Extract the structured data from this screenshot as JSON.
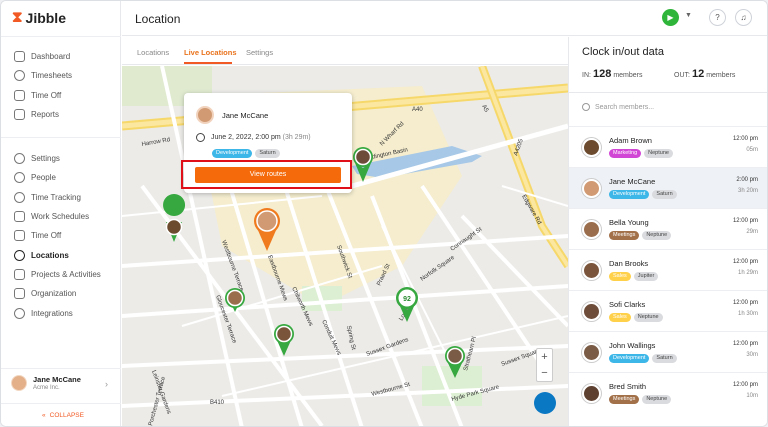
{
  "app": {
    "name": "Jibble",
    "brand_color": "#f15a24"
  },
  "sidebar": {
    "top_items": [
      {
        "label": "Dashboard",
        "icon": "dashboard-icon"
      },
      {
        "label": "Timesheets",
        "icon": "clock-icon"
      },
      {
        "label": "Time Off",
        "icon": "hourglass-icon"
      },
      {
        "label": "Reports",
        "icon": "report-icon"
      }
    ],
    "settings_items": [
      {
        "label": "Settings",
        "icon": "gear-icon"
      },
      {
        "label": "People",
        "icon": "people-icon"
      },
      {
        "label": "Time Tracking",
        "icon": "time-tracking-icon"
      },
      {
        "label": "Work Schedules",
        "icon": "schedule-icon"
      },
      {
        "label": "Time Off",
        "icon": "time-off-icon"
      },
      {
        "label": "Locations",
        "icon": "location-pin-icon",
        "active": true
      },
      {
        "label": "Projects & Activities",
        "icon": "tag-icon"
      },
      {
        "label": "Organization",
        "icon": "organization-icon"
      },
      {
        "label": "Integrations",
        "icon": "plug-icon"
      }
    ],
    "user": {
      "name": "Jane McCane",
      "org": "Acme Inc."
    },
    "collapse_label": "COLLAPSE"
  },
  "header": {
    "title": "Location",
    "status_color": "#2fb53a"
  },
  "tabs": [
    {
      "label": "Locations",
      "active": false
    },
    {
      "label": "Live Locations",
      "active": true
    },
    {
      "label": "Settings",
      "active": false
    }
  ],
  "map": {
    "street_labels": [
      "A40",
      "A5",
      "A4205",
      "Paddington Basin",
      "Westbourne Terrace",
      "Gloucester Terrace",
      "Praed St",
      "Spring St",
      "Sussex Gardens",
      "Norfolk Square",
      "London St",
      "Edgware Rd",
      "Harrow Rd",
      "B410",
      "Leinster Gardens",
      "Westbourne St",
      "Hyde Park Square",
      "Sussex Square",
      "Porchester Terrace",
      "Eastbourne Mews",
      "Chilworth Mews",
      "Southwick St",
      "N Wharf Rd",
      "Conduit Mews",
      "Strathearn Pl",
      "Connaught St"
    ],
    "cluster_count": "92",
    "popup": {
      "name": "Jane McCane",
      "datetime": "June 2, 2022, 2:00 pm",
      "duration": "(3h 29m)",
      "tags": [
        "Development",
        "Saturn"
      ],
      "button_label": "View routes"
    },
    "zoom_in": "+",
    "zoom_out": "−"
  },
  "panel": {
    "title": "Clock in/out data",
    "in_label": "IN:",
    "in_count": "128",
    "in_unit": "members",
    "out_label": "OUT:",
    "out_count": "12",
    "out_unit": "members",
    "search_placeholder": "Search members...",
    "members": [
      {
        "name": "Adam Brown",
        "tags": [
          "Marketing",
          "Neptune"
        ],
        "time": "12:00 pm",
        "dur": "05m",
        "selected": false
      },
      {
        "name": "Jane McCane",
        "tags": [
          "Development",
          "Saturn"
        ],
        "time": "2:00 pm",
        "dur": "3h 20m",
        "selected": true
      },
      {
        "name": "Bella Young",
        "tags": [
          "Meetings",
          "Neptune"
        ],
        "time": "12:00 pm",
        "dur": "29m",
        "selected": false
      },
      {
        "name": "Dan Brooks",
        "tags": [
          "Sales",
          "Jupiter"
        ],
        "time": "12:00 pm",
        "dur": "1h 29m",
        "selected": false
      },
      {
        "name": "Sofi Clarks",
        "tags": [
          "Sales",
          "Neptune"
        ],
        "time": "12:00 pm",
        "dur": "1h 30m",
        "selected": false
      },
      {
        "name": "John Wallings",
        "tags": [
          "Development",
          "Saturn"
        ],
        "time": "12:00 pm",
        "dur": "30m",
        "selected": false
      },
      {
        "name": "Bred Smith",
        "tags": [
          "Meetings",
          "Neptune"
        ],
        "time": "12:00 pm",
        "dur": "10m",
        "selected": false
      }
    ]
  }
}
